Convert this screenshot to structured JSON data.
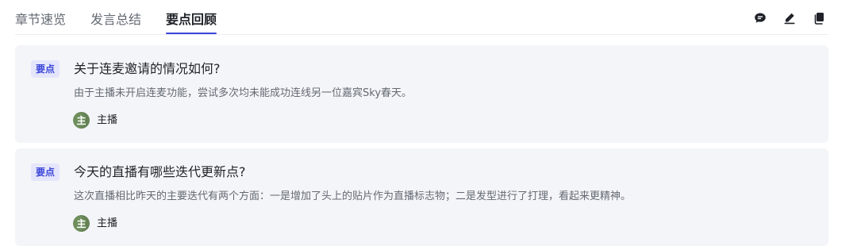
{
  "tabs": [
    {
      "label": "章节速览",
      "active": false
    },
    {
      "label": "发言总结",
      "active": false
    },
    {
      "label": "要点回顾",
      "active": true
    }
  ],
  "toolbar": {
    "icons": [
      "comment-icon",
      "edit-icon",
      "copy-icon"
    ]
  },
  "colors": {
    "accent": "#3b46d9",
    "card_bg": "#f4f5f8",
    "badge_bg": "#e5e6fb",
    "avatar": "#6e8e5c"
  },
  "points": [
    {
      "badge": "要点",
      "question": "关于连麦邀请的情况如何?",
      "answer": "由于主播未开启连麦功能，尝试多次均未能成功连线另一位嘉宾Sky春天。",
      "speaker_avatar": "主",
      "speaker": "主播"
    },
    {
      "badge": "要点",
      "question": "今天的直播有哪些迭代更新点?",
      "answer": "这次直播相比昨天的主要迭代有两个方面：一是增加了头上的贴片作为直播标志物；二是发型进行了打理，看起来更精神。",
      "speaker_avatar": "主",
      "speaker": "主播"
    }
  ]
}
